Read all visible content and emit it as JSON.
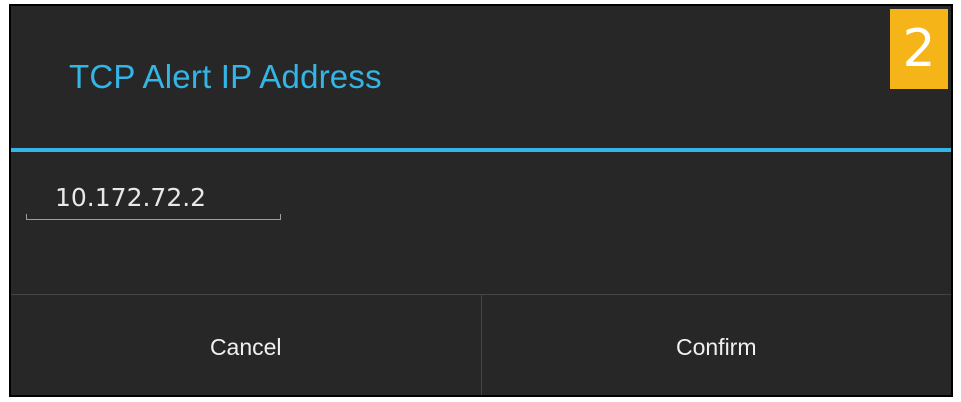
{
  "dialog": {
    "title": "TCP Alert IP Address",
    "step_badge": "2",
    "ip_value": "10.172.72.2",
    "buttons": {
      "cancel": "Cancel",
      "confirm": "Confirm"
    }
  },
  "colors": {
    "accent": "#33b5e5",
    "badge": "#f5b417",
    "background": "#272727"
  }
}
